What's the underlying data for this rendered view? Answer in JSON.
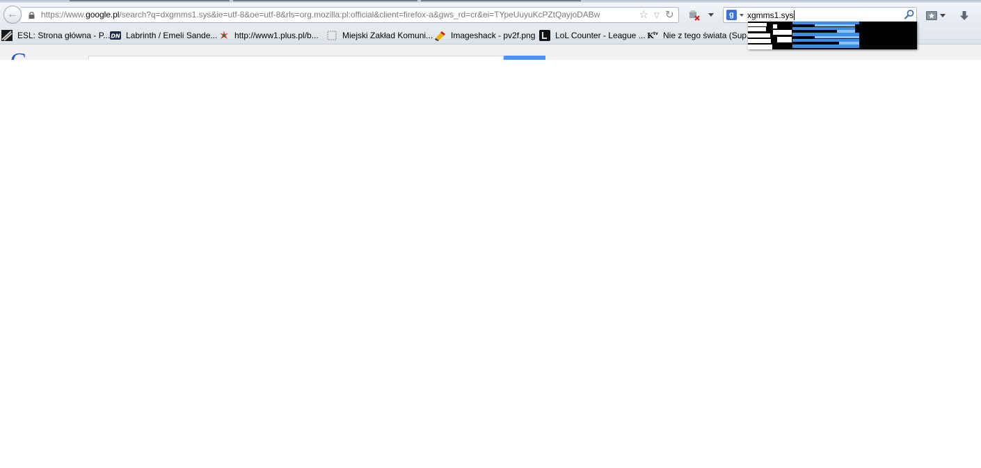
{
  "window": {
    "url_prefix": "https://www.",
    "url_host": "google.pl",
    "url_rest": "/search?q=dxgmms1.sys&ie=utf-8&oe=utf-8&rls=org.mozilla:pl:official&client=firefox-a&gws_rd=cr&ei=TYpeUuyuKcPZtQayjoDABw"
  },
  "toolbar": {
    "back_icon": "back-arrow-icon",
    "star_icon": "star-icon",
    "history_icon": "history-dropdown-icon",
    "reload_icon": "reload-icon",
    "addon_icon": "addon-icon",
    "bookmarks_icon": "bookmarks-menu-icon",
    "download_icon": "download-icon"
  },
  "search": {
    "engine_letter": "g",
    "value": "xgmms1.sys"
  },
  "bookmarks": [
    {
      "label": "ESL: Strona główna - P...",
      "icon": "esl-icon"
    },
    {
      "label": "Labrinth / Emeli Sande...",
      "icon": "dn-icon"
    },
    {
      "label": "http://www1.plus.pl/b...",
      "icon": "plus-icon"
    },
    {
      "label": "Miejski Zakład Komuni...",
      "icon": "blank-page-icon"
    },
    {
      "label": "Imageshack - pv2f.png",
      "icon": "imageshack-icon"
    },
    {
      "label": "LoL Counter - League ...",
      "icon": "lol-icon"
    },
    {
      "label": "Nie z tego świata (Sup...",
      "icon": "ktv-icon"
    }
  ],
  "colors": {
    "accent_blue": "#3f72d8",
    "google_button_blue": "#4d90fe",
    "suggest_blue": "#3b8ee6"
  }
}
